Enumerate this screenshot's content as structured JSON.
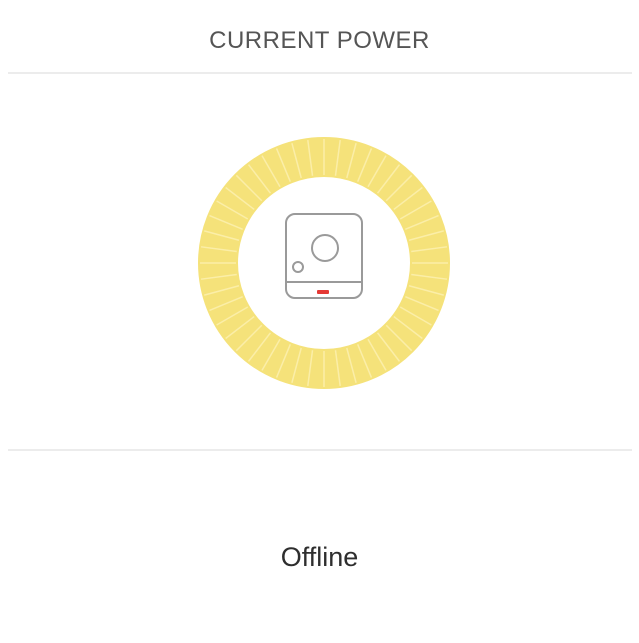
{
  "header": {
    "title": "CURRENT POWER"
  },
  "gauge": {
    "ring_color": "#f5e27a",
    "ring_tick_color": "#fbeea8",
    "icon": "smart-plug-icon",
    "indicator_color": "#e53935"
  },
  "status": {
    "label": "Offline"
  }
}
